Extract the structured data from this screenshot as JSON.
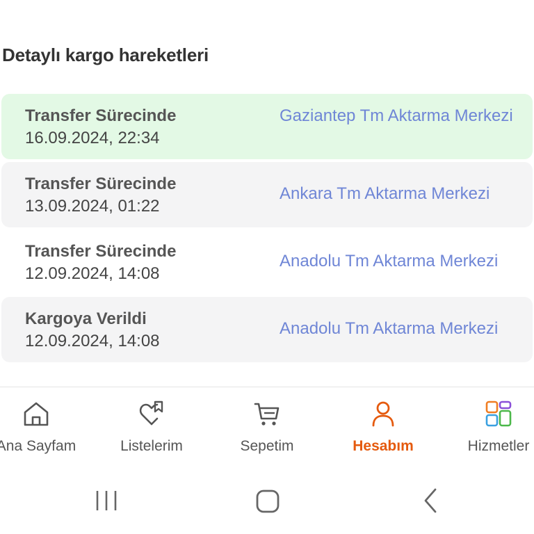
{
  "page": {
    "title": "Detaylı kargo hareketleri"
  },
  "movements": [
    {
      "status": "Transfer Sürecinde",
      "date": "16.09.2024, 22:34",
      "location": "Gaziantep Tm Aktarma Merkezi",
      "highlighted": true
    },
    {
      "status": "Transfer Sürecinde",
      "date": "13.09.2024, 01:22",
      "location": "Ankara Tm Aktarma Merkezi",
      "highlighted": false
    },
    {
      "status": "Transfer Sürecinde",
      "date": "12.09.2024, 14:08",
      "location": "Anadolu Tm Aktarma Merkezi",
      "highlighted": false
    },
    {
      "status": "Kargoya Verildi",
      "date": "12.09.2024, 14:08",
      "location": "Anadolu Tm Aktarma Merkezi",
      "highlighted": false
    }
  ],
  "bottom_nav": {
    "items": [
      {
        "label": "Ana Sayfam",
        "icon": "home-icon"
      },
      {
        "label": "Listelerim",
        "icon": "heart-list-icon"
      },
      {
        "label": "Sepetim",
        "icon": "cart-icon"
      },
      {
        "label": "Hesabım",
        "icon": "user-icon",
        "active": true
      },
      {
        "label": "Hizmetler",
        "icon": "services-grid-icon"
      }
    ]
  },
  "colors": {
    "highlight_bg": "#e3f9e5",
    "card_bg": "#f4f4f5",
    "link": "#6f86d6",
    "accent": "#e55a0e"
  }
}
